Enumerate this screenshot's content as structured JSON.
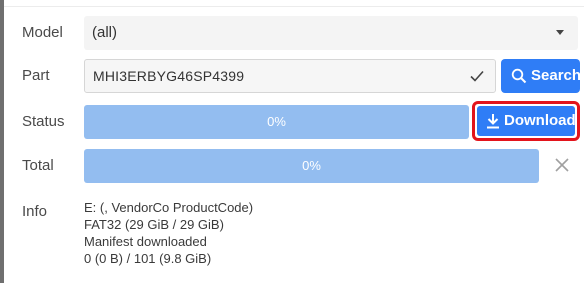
{
  "labels": {
    "model": "Model",
    "part": "Part",
    "status": "Status",
    "total": "Total",
    "info": "Info"
  },
  "model": {
    "selected": "(all)"
  },
  "part": {
    "value": "MHI3ERBYG46SP4399"
  },
  "buttons": {
    "search": "Search",
    "download": "Download"
  },
  "progress": {
    "status": "0%",
    "total": "0%"
  },
  "info": {
    "lines": [
      "E: (, VendorCo ProductCode)",
      "FAT32 (29 GiB / 29 GiB)",
      "Manifest downloaded",
      "0 (0 B) / 101 (9.8 GiB)"
    ]
  },
  "icons": {
    "search": "search-icon",
    "download": "download-icon",
    "check": "check-icon",
    "close": "close-icon",
    "caret": "chevron-down-icon"
  },
  "colors": {
    "accent": "#2f7df6",
    "progress": "#93bdf0",
    "highlight": "#e3141c"
  }
}
